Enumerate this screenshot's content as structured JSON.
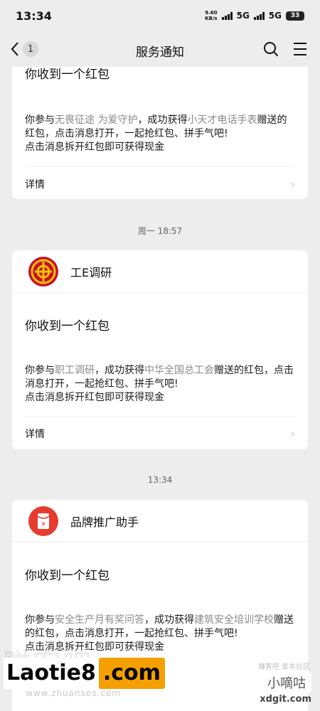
{
  "status_bar": {
    "time": "13:34",
    "speed_value": "9.60",
    "speed_unit": "KB/s",
    "network_1": "5G",
    "network_2": "5G",
    "battery": "33"
  },
  "nav": {
    "back_count": "1",
    "title": "服务通知",
    "icons": [
      "chevron-left-icon",
      "search-icon",
      "menu-icon"
    ]
  },
  "messages": [
    {
      "title": "你收到一个红包",
      "body_prefix": "你参与",
      "activity": "无畏征途 为爱守护",
      "body_middle": "，成功获得",
      "sponsor": "小天才电话手表",
      "body_suffix": "赠送的红包，点击消息打开，一起抢红包、拼手气吧!",
      "body_line3": "点击消息拆开红包即可获得现金",
      "details": "详情"
    },
    {
      "time": "周一 18:57",
      "app_name": "工E调研",
      "title": "你收到一个红包",
      "body_prefix": "你参与",
      "activity": "职工调研",
      "body_middle": "，成功获得",
      "sponsor": "中华全国总工会",
      "body_suffix": "赠送的红包，点击消息打开，一起抢红包、拼手气吧!",
      "body_line3": "点击消息拆开红包即可获得现金",
      "details": "详情"
    },
    {
      "time": "13:34",
      "app_name": "品牌推广助手",
      "title": "你收到一个红包",
      "body_prefix": "你参与",
      "activity": "安全生产月有奖问答",
      "body_middle": "，成功获得",
      "sponsor": "建筑安全培训学校",
      "body_suffix": "赠送的红包，点击消息打开，一起抢红包、拼手气吧!",
      "body_line3": "点击消息拆开红包即可获得现金"
    }
  ],
  "watermark": {
    "bg_text": "赚客吧",
    "brand_a": "Laotie8",
    "brand_b": ".com",
    "url": "www.zhuanses.com",
    "right_small": "赚客吧 爱羊社区",
    "right_big": "小嘀咕",
    "right_url": "xdgit.com"
  },
  "colors": {
    "background": "#ededed",
    "card": "#ffffff",
    "highlight_text": "#8a8a8a",
    "red_packet": "#e63b2e",
    "union_badge": "#c8102e",
    "watermark_orange": "#f5a000"
  }
}
